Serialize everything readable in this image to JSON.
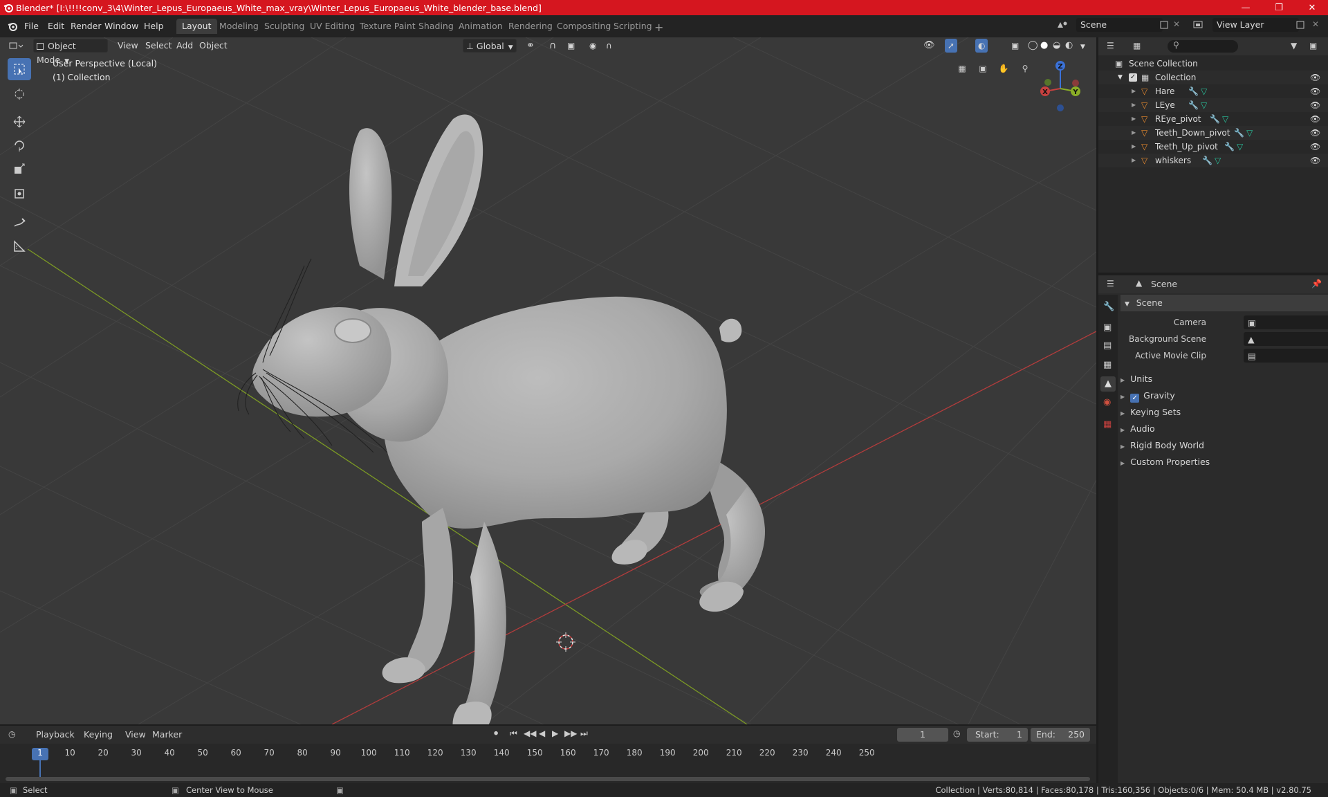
{
  "window": {
    "title": "Blender* [I:\\!!!!conv_3\\4\\Winter_Lepus_Europaeus_White_max_vray\\Winter_Lepus_Europaeus_White_blender_base.blend]",
    "controls": [
      "minimize-icon",
      "maximize-icon",
      "close-icon"
    ]
  },
  "menubar": {
    "items": [
      "File",
      "Edit",
      "Render",
      "Window",
      "Help"
    ]
  },
  "workspaces": [
    "Layout",
    "Modeling",
    "Sculpting",
    "UV Editing",
    "Texture Paint",
    "Shading",
    "Animation",
    "Rendering",
    "Compositing",
    "Scripting"
  ],
  "scene_selector": {
    "value": "Scene"
  },
  "viewlayer_selector": {
    "value": "View Layer"
  },
  "viewport": {
    "mode": "Object Mode",
    "menus": [
      "View",
      "Select",
      "Add",
      "Object"
    ],
    "transform_orientation": "Global",
    "overlay_line1": "User Perspective (Local)",
    "overlay_line2": "(1) Collection",
    "gizmo_axes": [
      "X",
      "Y",
      "Z"
    ],
    "background": "#393939",
    "model": "white hare sculpt (gray clay shading)"
  },
  "outliner": {
    "root": "Scene Collection",
    "collection": "Collection",
    "objects": [
      "Hare",
      "LEye",
      "REye_pivot",
      "Teeth_Down_pivot",
      "Teeth_Up_pivot",
      "whiskers"
    ]
  },
  "properties": {
    "header": "Scene",
    "panel_title": "Scene",
    "fields": [
      {
        "label": "Camera",
        "value": ""
      },
      {
        "label": "Background Scene",
        "value": ""
      },
      {
        "label": "Active Movie Clip",
        "value": ""
      }
    ],
    "subpanels": [
      "Units",
      "Gravity",
      "Keying Sets",
      "Audio",
      "Rigid Body World",
      "Custom Properties"
    ],
    "gravity_checked": true
  },
  "timeline": {
    "menus": [
      "Playback",
      "Keying",
      "View",
      "Marker"
    ],
    "current_frame": "1",
    "start_label": "Start:",
    "start": "1",
    "end_label": "End:",
    "end": "250",
    "ruler": [
      "1",
      "10",
      "20",
      "30",
      "40",
      "50",
      "60",
      "70",
      "80",
      "90",
      "100",
      "110",
      "120",
      "130",
      "140",
      "150",
      "160",
      "170",
      "180",
      "190",
      "200",
      "210",
      "220",
      "230",
      "240",
      "250"
    ]
  },
  "statusbar": {
    "left": "Select",
    "middle": "Center View to Mouse",
    "right": "Collection | Verts:80,814 | Faces:80,178 | Tris:160,356 | Objects:0/6 | Mem: 50.4 MB | v2.80.75"
  },
  "colors": {
    "titlebar": "#d5161f",
    "accent": "#4772b3",
    "x_axis": "#c8413f",
    "y_axis": "#8aae27",
    "z_axis": "#3b72d8"
  }
}
